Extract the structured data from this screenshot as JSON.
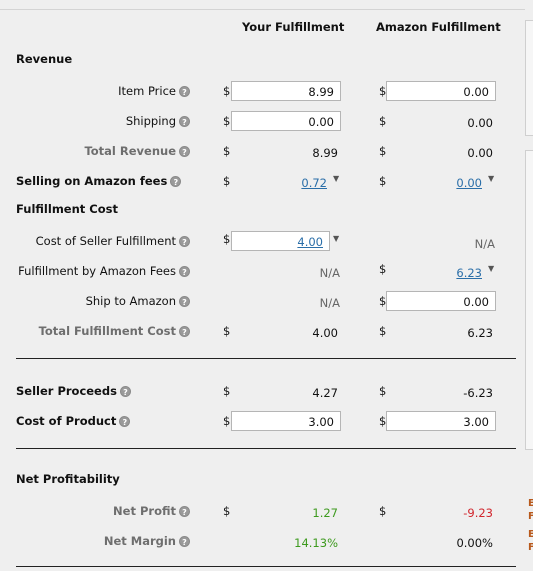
{
  "headers": {
    "your": "Your Fulfillment",
    "amazon": "Amazon Fulfillment"
  },
  "sections": {
    "revenue": "Revenue",
    "fulfillment_cost": "Fulfillment Cost",
    "net_profitability": "Net Profitability"
  },
  "currency": "$",
  "help_glyph": "?",
  "caret_glyph": "▼",
  "rows": {
    "item_price": {
      "label": "Item Price",
      "your": "8.99",
      "amazon": "0.00"
    },
    "shipping": {
      "label": "Shipping",
      "your": "0.00",
      "amazon": "0.00"
    },
    "total_revenue": {
      "label": "Total Revenue",
      "your": "8.99",
      "amazon": "0.00"
    },
    "selling_fees": {
      "label": "Selling on Amazon fees",
      "your": "0.72",
      "amazon": "0.00"
    },
    "cost_seller_fulfillment": {
      "label": "Cost of Seller Fulfillment",
      "your": "4.00",
      "amazon": "N/A"
    },
    "fba_fees": {
      "label": "Fulfillment by Amazon Fees",
      "your": "N/A",
      "amazon": "6.23"
    },
    "ship_to_amazon": {
      "label": "Ship to Amazon",
      "your": "N/A",
      "amazon": "0.00"
    },
    "total_fulfillment_cost": {
      "label": "Total Fulfillment Cost",
      "your": "4.00",
      "amazon": "6.23"
    },
    "seller_proceeds": {
      "label": "Seller Proceeds",
      "your": "4.27",
      "amazon": "-6.23"
    },
    "cost_of_product": {
      "label": "Cost of Product",
      "your": "3.00",
      "amazon": "3.00"
    },
    "net_profit": {
      "label": "Net Profit",
      "your": "1.27",
      "amazon": "-9.23"
    },
    "net_margin": {
      "label": "Net Margin",
      "your": "14.13%",
      "amazon": "0.00%"
    }
  },
  "edge_notes": [
    "E",
    "F",
    "E",
    "F"
  ],
  "colors": {
    "positive": "#3d9a1e",
    "negative": "#d1252c",
    "link": "#2a6ea8",
    "edge_note": "#b8591c"
  }
}
